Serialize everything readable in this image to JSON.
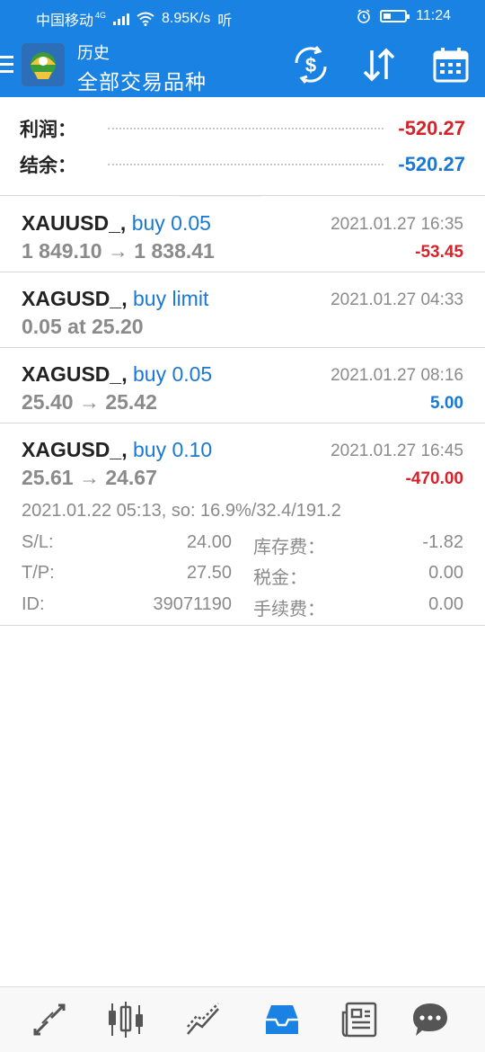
{
  "status_bar": {
    "carrier": "中国移动",
    "network": "4G",
    "speed": "8.95K/s",
    "extra": "听",
    "time": "11:24",
    "battery_level": 0.35
  },
  "header": {
    "section": "历史",
    "title": "全部交易品种",
    "icons": [
      "menu-icon",
      "app-logo",
      "currency-exchange-icon",
      "sort-icon",
      "calendar-icon"
    ],
    "accent_color": "#1a82e2"
  },
  "summary": {
    "profit_label": "利润：",
    "profit_value": "-520.27",
    "balance_label": "结余：",
    "balance_value": "-520.27"
  },
  "orders": [
    {
      "symbol": "XAUUSD_,",
      "side": "buy 0.05",
      "time": "2021.01.27 16:35",
      "prices": "1 849.10 → 1 838.41",
      "profit": "-53.45"
    },
    {
      "symbol": "XAGUSD_,",
      "side": "buy limit",
      "time": "2021.01.27 04:33",
      "prices": "0.05 at 25.20",
      "profit": ""
    },
    {
      "symbol": "XAGUSD_,",
      "side": "buy 0.05",
      "time": "2021.01.27 08:16",
      "prices": "25.40 → 25.42",
      "profit": "5.00"
    },
    {
      "symbol": "XAGUSD_,",
      "side": "buy 0.10",
      "time": "2021.01.27 16:45",
      "prices": "25.61 → 24.67",
      "profit": "-470.00",
      "detail": {
        "opened": "2021.01.22 05:13, so: 16.9%/32.4/191.2",
        "sl_label": "S/L:",
        "sl_value": "24.00",
        "swap_label": "库存费：",
        "swap_value": "-1.82",
        "tp_label": "T/P:",
        "tp_value": "27.50",
        "tax_label": "税金：",
        "tax_value": "0.00",
        "id_label": "ID:",
        "id_value": "39071190",
        "fee_label": "手续费：",
        "fee_value": "0.00"
      }
    }
  ],
  "bottom_nav": {
    "items": [
      "trade-icon",
      "chart-candles-icon",
      "trend-lines-icon",
      "history-inbox-icon",
      "news-icon",
      "chat-icon"
    ],
    "active_index": 3,
    "active_color": "#1a82e2",
    "inactive_color": "#555555"
  }
}
